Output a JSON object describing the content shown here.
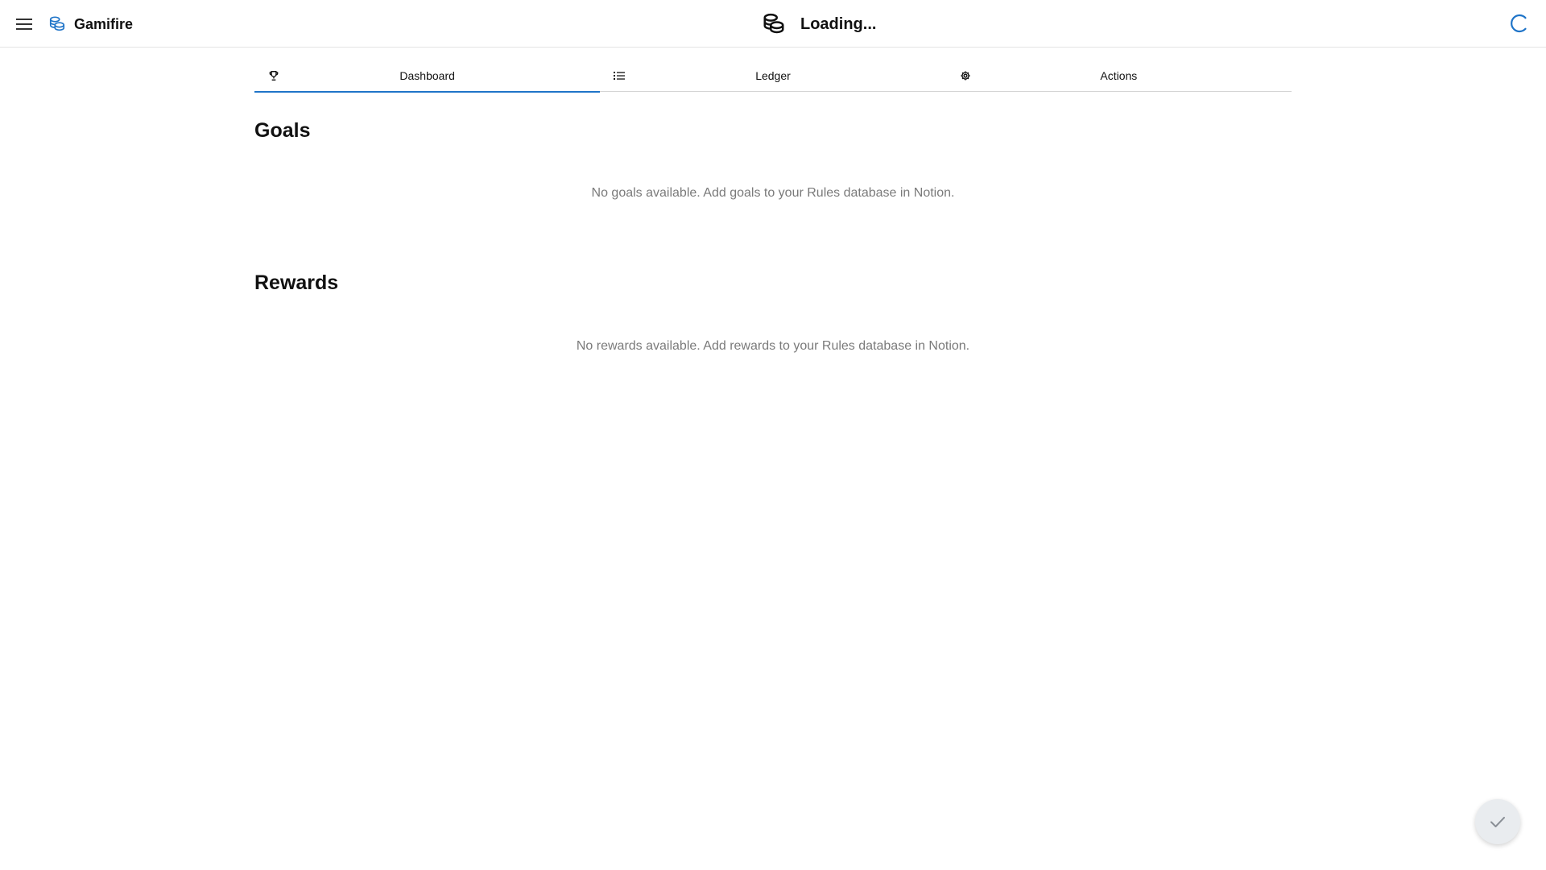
{
  "header": {
    "brand_name": "Gamifire",
    "title": "Loading...",
    "accent": "#1f74c8"
  },
  "tabs": [
    {
      "label": "Dashboard",
      "icon": "trophy-icon",
      "active": true
    },
    {
      "label": "Ledger",
      "icon": "list-icon",
      "active": false
    },
    {
      "label": "Actions",
      "icon": "gear-icon",
      "active": false
    }
  ],
  "goals": {
    "title": "Goals",
    "empty_message": "No goals available. Add goals to your Rules database in Notion."
  },
  "rewards": {
    "title": "Rewards",
    "empty_message": "No rewards available. Add rewards to your Rules database in Notion."
  },
  "fab": {
    "icon": "check-icon"
  }
}
